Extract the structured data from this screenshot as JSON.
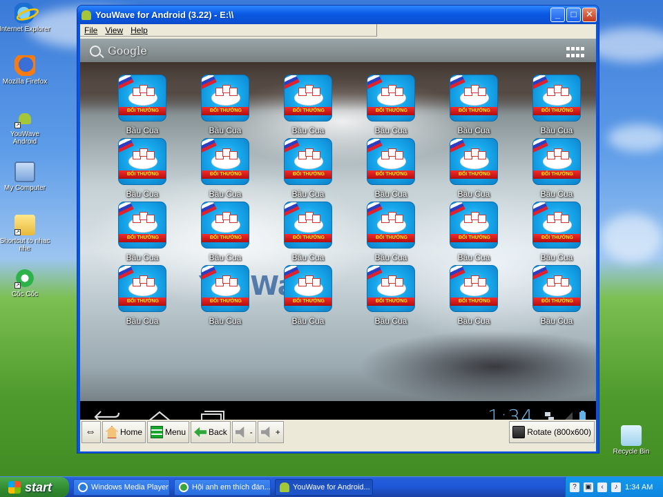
{
  "desktop": {
    "icons": [
      {
        "label": "Internet Explorer",
        "icon": "internet-explorer-icon"
      },
      {
        "label": "Mozilla Firefox",
        "icon": "firefox-icon"
      },
      {
        "label": "YouWave Android",
        "icon": "youwave-icon"
      },
      {
        "label": "My Computer",
        "icon": "my-computer-icon"
      },
      {
        "label": "Shortcut to nhac nhe",
        "icon": "folder-icon"
      },
      {
        "label": "Cốc Cốc",
        "icon": "coccoc-icon"
      },
      {
        "label": "Recycle Bin",
        "icon": "recycle-bin-icon"
      }
    ]
  },
  "window": {
    "title": "YouWave for Android (3.22) - E:\\\\",
    "controls": {
      "minimize": "_",
      "maximize": "□",
      "close": "✕"
    },
    "menu": [
      "File",
      "View",
      "Help"
    ]
  },
  "android": {
    "search_text": "Google",
    "watermark": "YouWave",
    "clock": "1:34",
    "apps": [
      "Bầu Cua",
      "Bầu Cua",
      "Bầu Cua",
      "Bầu Cua",
      "Bầu Cua",
      "Bầu Cua",
      "Bầu Cua",
      "Bầu Cua",
      "Bầu Cua",
      "Bầu Cua",
      "Bầu Cua",
      "Bầu Cua",
      "Bầu Cua",
      "Bầu Cua",
      "Bầu Cua",
      "Bầu Cua",
      "Bầu Cua",
      "Bầu Cua",
      "Bầu Cua",
      "Bầu Cua",
      "Bầu Cua",
      "Bầu Cua",
      "Bầu Cua",
      "Bầu Cua"
    ],
    "app_ribbon": "ĐỔI THƯỞNG"
  },
  "toolbar": {
    "home": "Home",
    "menu": "Menu",
    "back": "Back",
    "vol_down": "-",
    "vol_up": "+",
    "rotate": "Rotate (800x600)"
  },
  "taskbar": {
    "start": "start",
    "tasks": [
      {
        "label": "Windows Media Player",
        "color": "#2d7de0"
      },
      {
        "label": "Hội anh em thích đán...",
        "color": "#3aa53a"
      },
      {
        "label": "YouWave for Android...",
        "color": "#a4c639"
      }
    ],
    "time": "1:34 AM"
  },
  "colors": {
    "titlebar": "#0a5ae4",
    "taskbar": "#245edb",
    "clock": "#6fb8e8"
  }
}
